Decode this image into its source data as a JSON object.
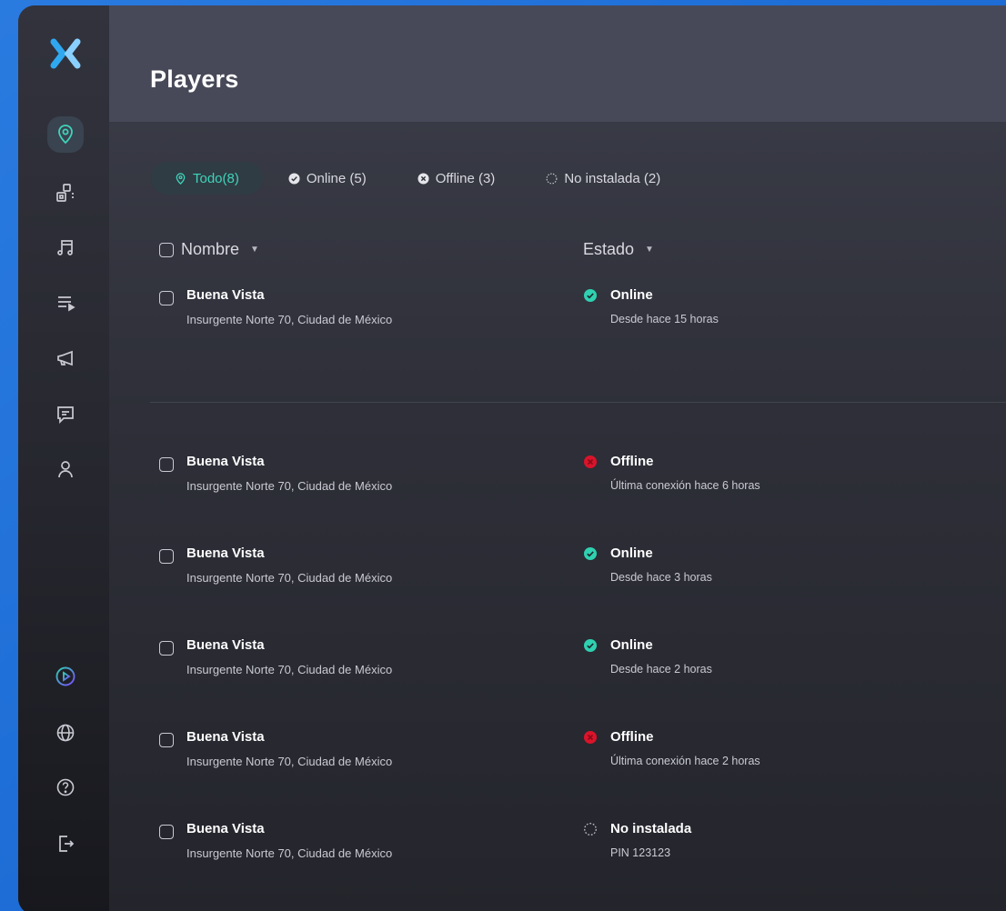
{
  "header": {
    "title": "Players"
  },
  "tabs": [
    {
      "label": "Todo(8)",
      "icon": "location-pin-icon",
      "active": true
    },
    {
      "label": "Online (5)",
      "icon": "check-circle-icon",
      "active": false
    },
    {
      "label": "Offline (3)",
      "icon": "x-circle-icon",
      "active": false
    },
    {
      "label": "No instalada (2)",
      "icon": "dashed-circle-icon",
      "active": false
    }
  ],
  "columns": {
    "name": "Nombre",
    "status": "Estado"
  },
  "rows": [
    {
      "name": "Buena Vista",
      "address": "Insurgente Norte 70, Ciudad de México",
      "status": "Online",
      "detail": "Desde hace 15 horas"
    },
    {
      "name": "Buena Vista",
      "address": "Insurgente Norte 70, Ciudad de México",
      "status": "Offline",
      "detail": "Última conexión hace 6 horas"
    },
    {
      "name": "Buena Vista",
      "address": "Insurgente Norte 70, Ciudad de México",
      "status": "Online",
      "detail": "Desde hace 3 horas"
    },
    {
      "name": "Buena Vista",
      "address": "Insurgente Norte 70, Ciudad de México",
      "status": "Online",
      "detail": "Desde hace 2 horas"
    },
    {
      "name": "Buena Vista",
      "address": "Insurgente Norte 70, Ciudad de México",
      "status": "Offline",
      "detail": "Última conexión hace 2 horas"
    },
    {
      "name": "Buena Vista",
      "address": "Insurgente Norte 70, Ciudad de México",
      "status": "No instalada",
      "detail": "PIN 123123"
    }
  ],
  "sidebar": {
    "items": [
      "location-icon",
      "devices-icon",
      "music-icon",
      "playlist-icon",
      "megaphone-icon",
      "chat-icon",
      "user-icon"
    ],
    "bottom": [
      "play-icon",
      "globe-icon",
      "help-icon",
      "logout-icon"
    ]
  },
  "colors": {
    "online": "#2fd1b1",
    "offline": "#d9142a",
    "accent": "#3fd3b9",
    "brand_blue": "#2a7be0"
  }
}
